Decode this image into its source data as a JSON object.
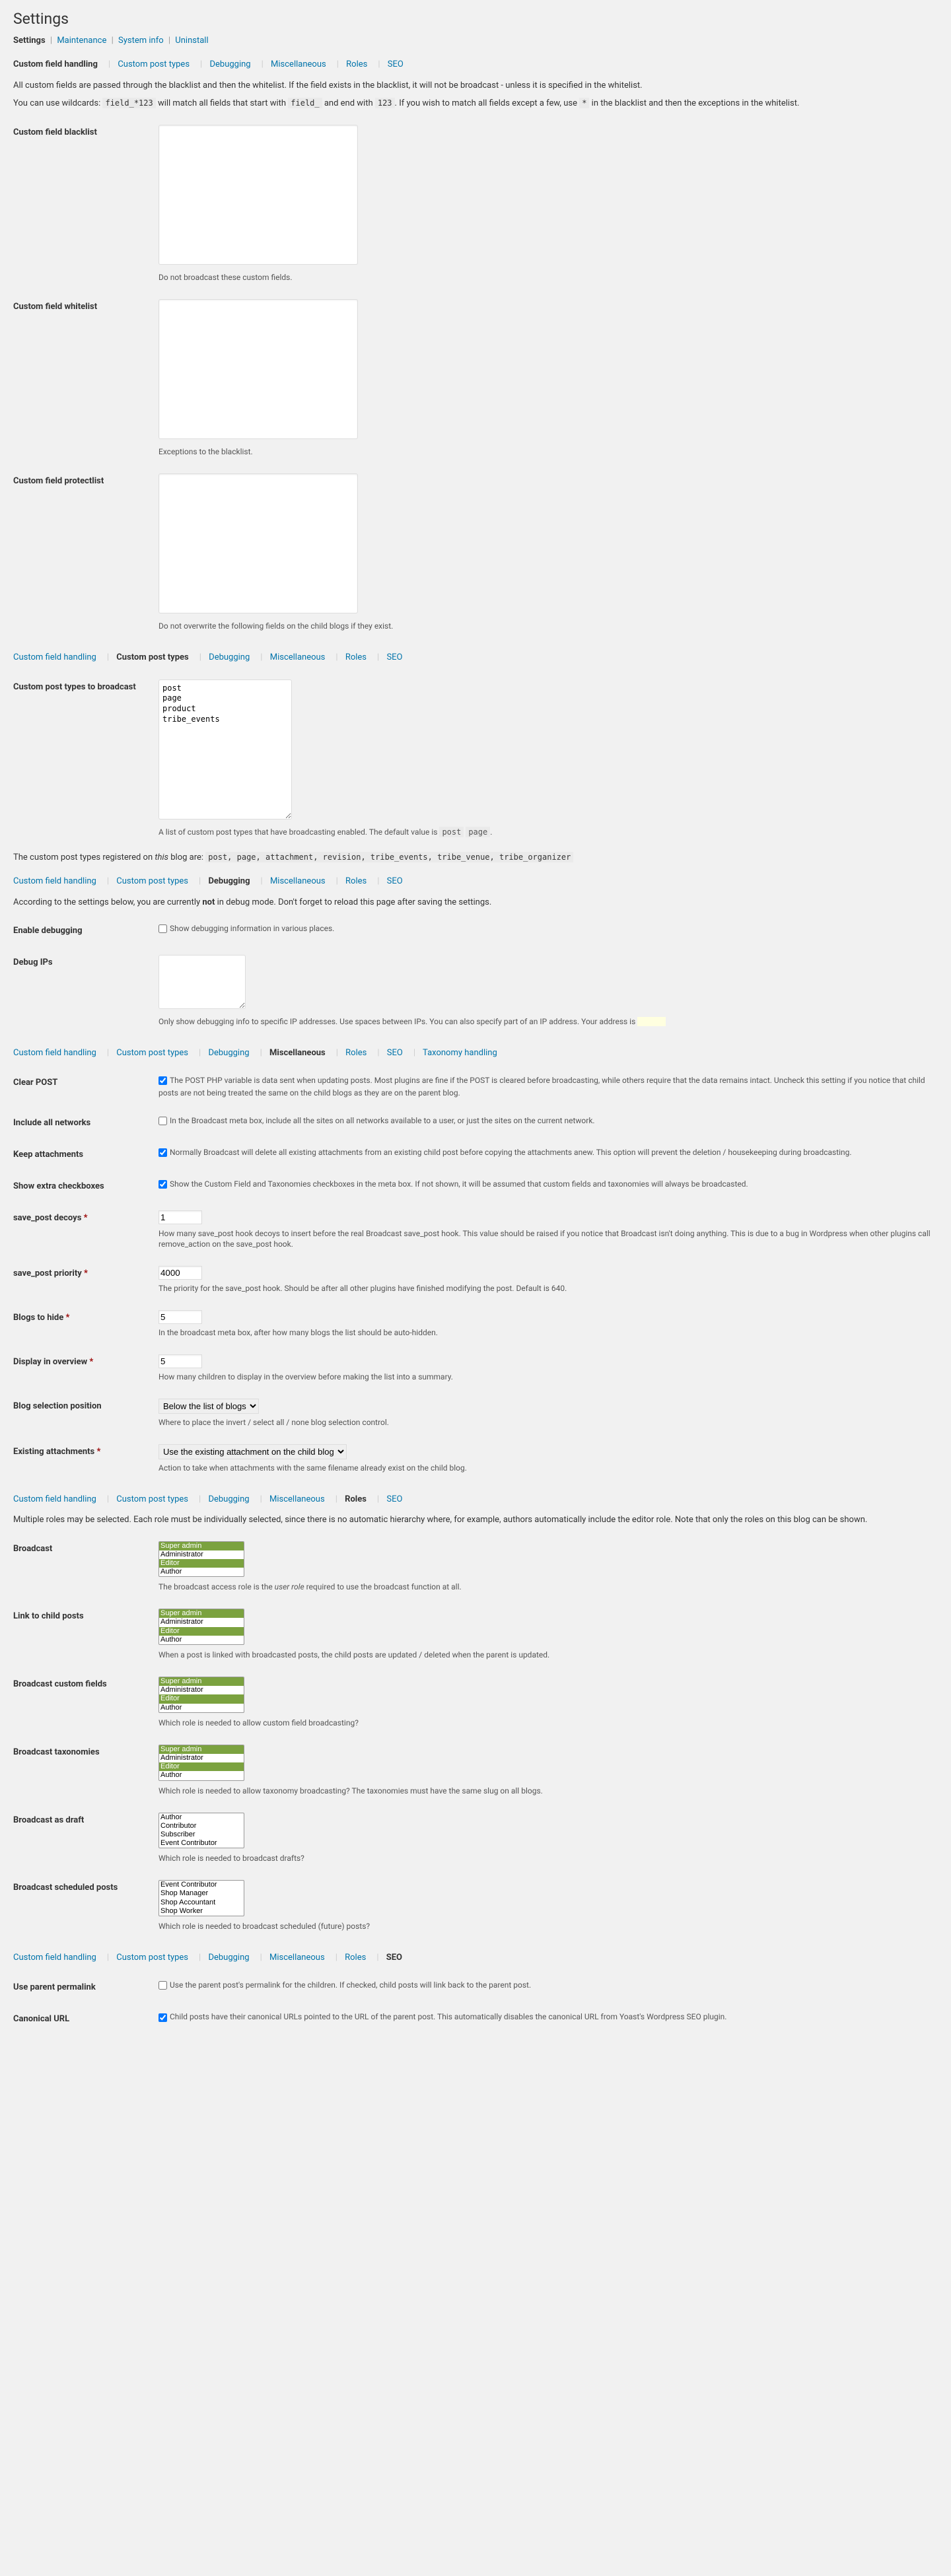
{
  "title": "Settings",
  "top_tabs": [
    "Settings",
    "Maintenance",
    "System info",
    "Uninstall"
  ],
  "sections_nav": [
    "Custom field handling",
    "Custom post types",
    "Debugging",
    "Miscellaneous",
    "Roles",
    "SEO"
  ],
  "taxonomy_nav_extra": "Taxonomy handling",
  "cfh": {
    "intro": "All custom fields are passed through the blacklist and then the whitelist. If the field exists in the blacklist, it will not be broadcast - unless it is specified in the whitelist.",
    "wild_pre": "You can use wildcards: ",
    "wild_c1": "field_*123",
    "wild_m1": " will match all fields that start with ",
    "wild_c2": "field_",
    "wild_m2": " and end with ",
    "wild_c3": "123",
    "wild_m3": ". If you wish to match all fields except a few, use ",
    "wild_c4": "*",
    "wild_post": " in the blacklist and then the exceptions in the whitelist.",
    "blacklist_label": "Custom field blacklist",
    "blacklist_desc": "Do not broadcast these custom fields.",
    "whitelist_label": "Custom field whitelist",
    "whitelist_desc": "Exceptions to the blacklist.",
    "protect_label": "Custom field protectlist",
    "protect_desc": "Do not overwrite the following fields on the child blogs if they exist."
  },
  "cpt": {
    "label": "Custom post types to broadcast",
    "value": "post\npage\nproduct\ntribe_events",
    "desc_pre": "A list of custom post types that have broadcasting enabled. The default value is ",
    "desc_c1": "post",
    "desc_c2": "page",
    "desc_post": ".",
    "registered_pre": "The custom post types registered on ",
    "registered_mid": " blog are: ",
    "registered_list": "post, page, attachment, revision, tribe_events, tribe_venue, tribe_organizer",
    "this": "this"
  },
  "dbg": {
    "note_pre": "According to the settings below, you are currently ",
    "note_not": "not",
    "note_post": " in debug mode. Don't forget to reload this page after saving the settings.",
    "enable_label": "Enable debugging",
    "enable_desc": "Show debugging information in various places.",
    "ips_label": "Debug IPs",
    "ips_desc": "Only show debugging info to specific IP addresses. Use spaces between IPs. You can also specify part of an IP address. Your address is "
  },
  "misc": {
    "clear_post_label": "Clear POST",
    "clear_post_desc": "The POST PHP variable is data sent when updating posts. Most plugins are fine if the POST is cleared before broadcasting, while others require that the data remains intact. Uncheck this setting if you notice that child posts are not being treated the same on the child blogs as they are on the parent blog.",
    "inc_net_label": "Include all networks",
    "inc_net_desc": "In the Broadcast meta box, include all the sites on all networks available to a user, or just the sites on the current network.",
    "keep_att_label": "Keep attachments",
    "keep_att_desc": "Normally Broadcast will delete all existing attachments from an existing child post before copying the attachments anew. This option will prevent the deletion / housekeeping during broadcasting.",
    "extra_cb_label": "Show extra checkboxes",
    "extra_cb_desc": "Show the Custom Field and Taxonomies checkboxes in the meta box. If not shown, it will be assumed that custom fields and taxonomies will always be broadcasted.",
    "decoys_label": "save_post decoys",
    "decoys_val": "1",
    "decoys_desc": "How many save_post hook decoys to insert before the real Broadcast save_post hook. This value should be raised if you notice that Broadcast isn't doing anything. This is due to a bug in Wordpress when other plugins call remove_action on the save_post hook.",
    "priority_label": "save_post priority",
    "priority_val": "4000",
    "priority_desc": "The priority for the save_post hook. Should be after all other plugins have finished modifying the post. Default is 640.",
    "hide_label": "Blogs to hide",
    "hide_val": "5",
    "hide_desc": "In the broadcast meta box, after how many blogs the list should be auto-hidden.",
    "overview_label": "Display in overview",
    "overview_val": "5",
    "overview_desc": "How many children to display in the overview before making the list into a summary.",
    "pos_label": "Blog selection position",
    "pos_val": "Below the list of blogs",
    "pos_desc": "Where to place the invert / select all / none blog selection control.",
    "exist_label": "Existing attachments",
    "exist_val": "Use the existing attachment on the child blog",
    "exist_desc": "Action to take when attachments with the same filename already exist on the child blog."
  },
  "roles": {
    "intro": "Multiple roles may be selected. Each role must be individually selected, since there is no automatic hierarchy where, for example, authors automatically include the editor role. Note that only the roles on this blog can be shown.",
    "opts": [
      "Super admin",
      "Administrator",
      "Editor",
      "Author"
    ],
    "opts2": [
      "Author",
      "Contributor",
      "Subscriber",
      "Event Contributor"
    ],
    "opts3": [
      "Event Contributor",
      "Shop Manager",
      "Shop Accountant",
      "Shop Worker"
    ],
    "bcast_label": "Broadcast",
    "bcast_desc_pre": "The broadcast access role is the ",
    "bcast_desc_em": "user role",
    "bcast_desc_post": " required to use the broadcast function at all.",
    "link_label": "Link to child posts",
    "link_desc": "When a post is linked with broadcasted posts, the child posts are updated / deleted when the parent is updated.",
    "cf_label": "Broadcast custom fields",
    "cf_desc": "Which role is needed to allow custom field broadcasting?",
    "tax_label": "Broadcast taxonomies",
    "tax_desc": "Which role is needed to allow taxonomy broadcasting? The taxonomies must have the same slug on all blogs.",
    "draft_label": "Broadcast as draft",
    "draft_desc": "Which role is needed to broadcast drafts?",
    "sched_label": "Broadcast scheduled posts",
    "sched_desc": "Which role is needed to broadcast scheduled (future) posts?"
  },
  "seo": {
    "perma_label": "Use parent permalink",
    "perma_desc": "Use the parent post's permalink for the children. If checked, child posts will link back to the parent post.",
    "canon_label": "Canonical URL",
    "canon_desc": "Child posts have their canonical URLs pointed to the URL of the parent post. This automatically disables the canonical URL from Yoast's Wordpress SEO plugin."
  }
}
